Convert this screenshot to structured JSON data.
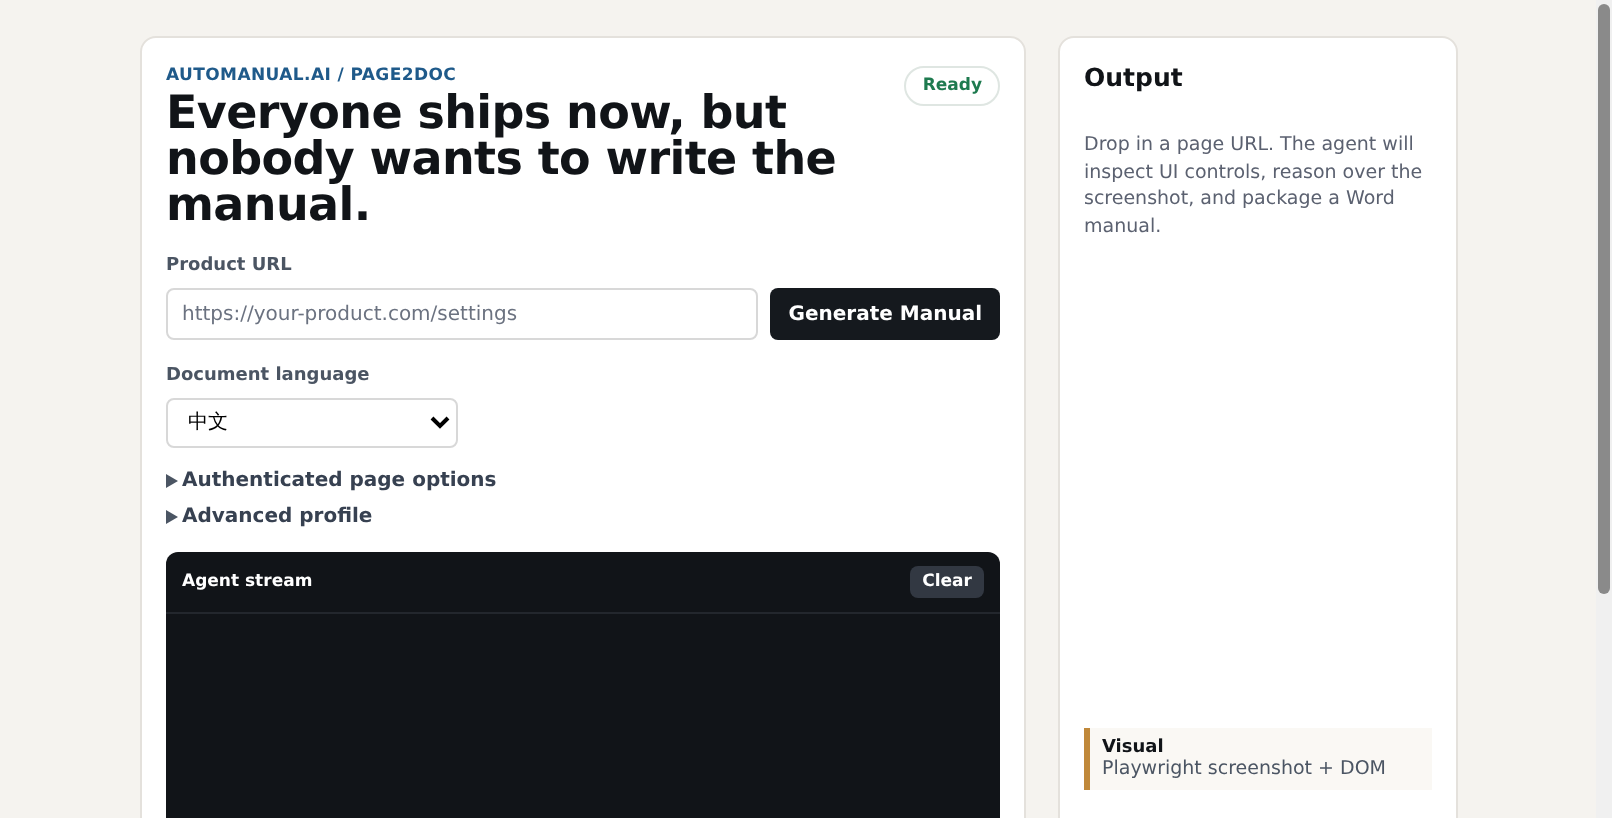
{
  "breadcrumb": "AUTOMANUAL.AI / PAGE2DOC",
  "status_badge": "Ready",
  "headline": "Everyone ships now, but nobody wants to write the manual.",
  "url_field": {
    "label": "Product URL",
    "placeholder": "https://your-product.com/settings"
  },
  "generate_button": "Generate Manual",
  "language": {
    "label": "Document language",
    "value": "中文"
  },
  "sections": [
    {
      "label": "Authenticated page options",
      "expanded": false
    },
    {
      "label": "Advanced profile",
      "expanded": false
    }
  ],
  "stream": {
    "title": "Agent stream",
    "clear_button": "Clear"
  },
  "output": {
    "title": "Output",
    "description": "Drop in a page URL. The agent will inspect UI controls, reason over the screenshot, and package a Word manual."
  },
  "callout": {
    "title": "Visual",
    "text": "Playwright screenshot + DOM"
  }
}
